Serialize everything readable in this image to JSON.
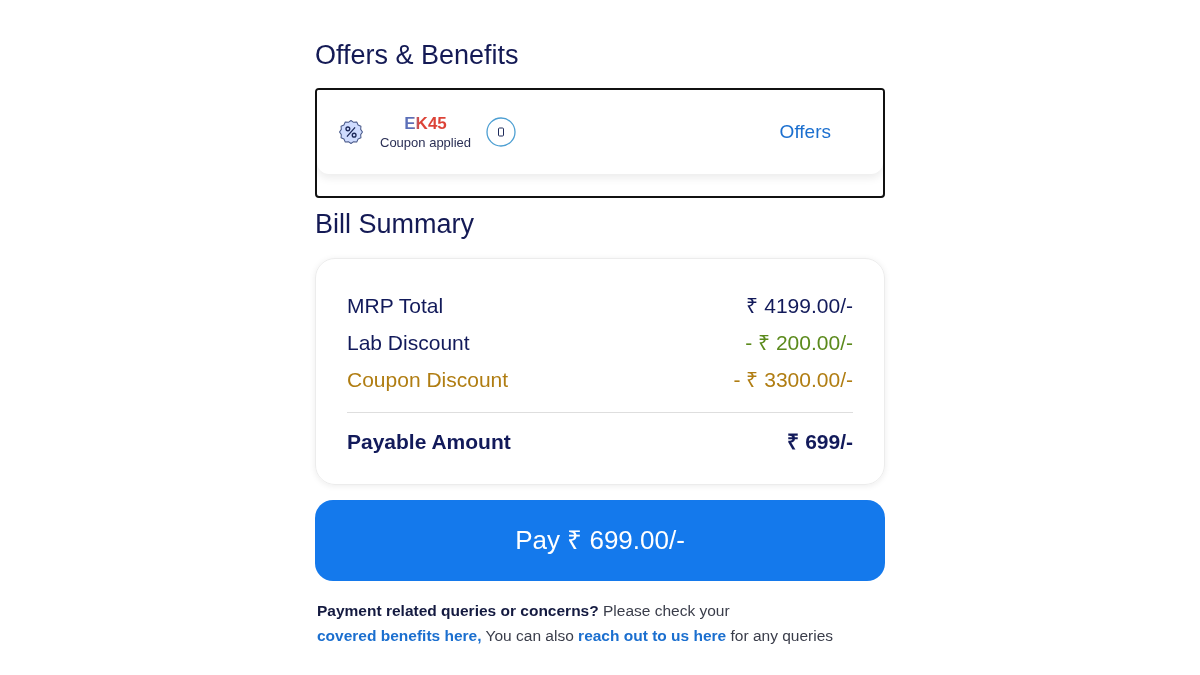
{
  "offers_section": {
    "title": "Offers & Benefits",
    "coupon": {
      "code": "EK45",
      "status": "Coupon applied"
    },
    "offers_link": "Offers"
  },
  "bill_summary": {
    "title": "Bill Summary",
    "rows": [
      {
        "kind": "total",
        "label": "MRP Total",
        "value": "₹ 4199.00/-"
      },
      {
        "kind": "lab_discount",
        "label": "Lab Discount",
        "value": "- ₹ 200.00/-"
      },
      {
        "kind": "coupon_discount",
        "label": "Coupon Discount",
        "value": "- ₹ 3300.00/-"
      }
    ],
    "payable": {
      "label": "Payable Amount",
      "value": "₹ 699/-"
    }
  },
  "pay_button": "Pay ₹ 699.00/-",
  "help_text": [
    {
      "kind": "bold",
      "text": "Payment related queries or concerns?"
    },
    {
      "kind": "plain",
      "text": "Please check your"
    },
    {
      "kind": "link",
      "text": "covered benefits here,"
    },
    {
      "kind": "plain",
      "text": "You can also"
    },
    {
      "kind": "link",
      "text": "reach out to us here"
    },
    {
      "kind": "plain",
      "text": "for any queries"
    }
  ]
}
